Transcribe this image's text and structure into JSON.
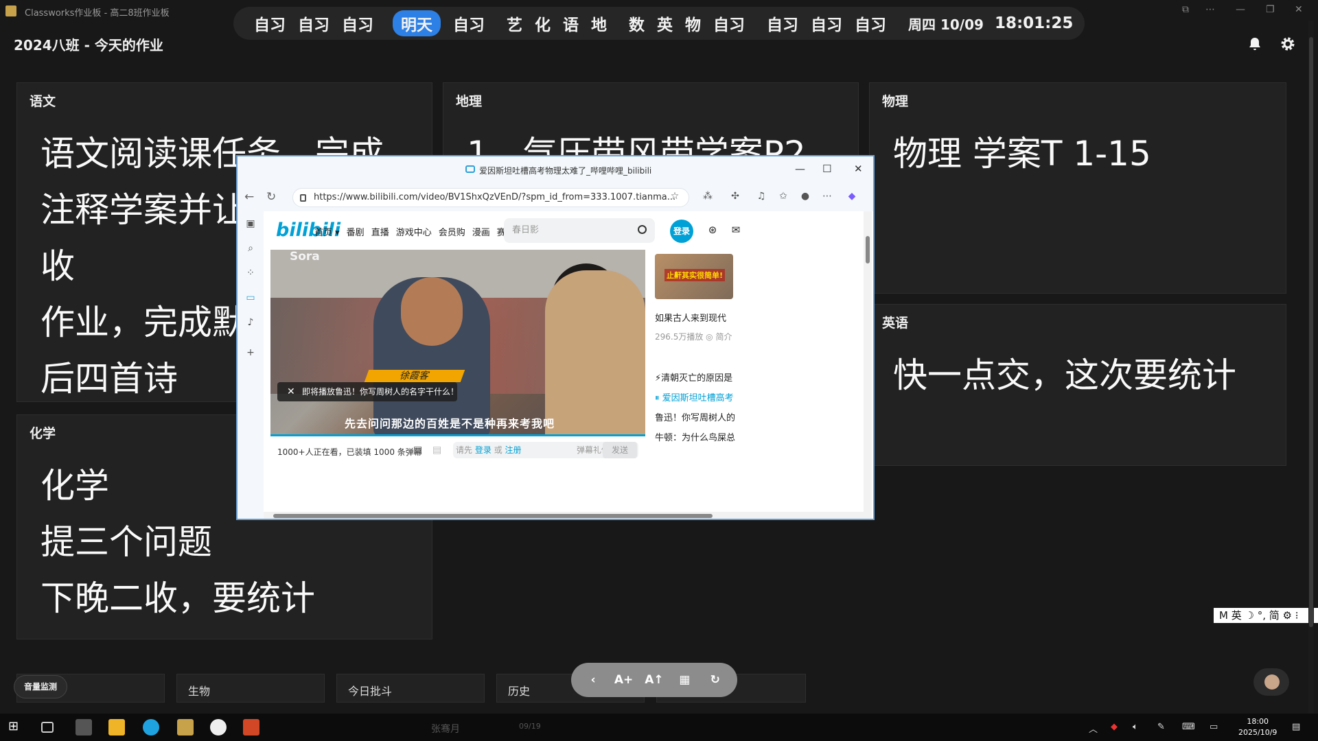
{
  "app": {
    "window_title": "Classworks作业板 - 高二8班作业板",
    "class_title": "2024八班 - 今天的作业"
  },
  "schedule": {
    "group1": [
      "自习",
      "自习",
      "自习"
    ],
    "highlight": "明天",
    "group2_rest": [
      "自习"
    ],
    "group3": [
      "艺",
      "化",
      "语",
      "地"
    ],
    "group4": [
      "数",
      "英",
      "物",
      "自习"
    ],
    "group5": [
      "自习",
      "自习",
      "自习"
    ],
    "weekday_date": "周四 10/09",
    "time": "18:01:25"
  },
  "cards": {
    "chinese": {
      "title": "语文",
      "lines": [
        "语文阅读课任务，完成",
        "注释学案并让课代表收",
        "收",
        "作业，完成默写",
        "后四首诗"
      ]
    },
    "geography": {
      "title": "地理",
      "lines": [
        "1、气压带风带学案P2"
      ]
    },
    "physics": {
      "title": "物理",
      "lines": [
        "物理 学案T 1-15"
      ]
    },
    "english": {
      "title": "英语",
      "lines": [
        "快一点交，这次要统计"
      ]
    },
    "chemistry": {
      "title": "化学",
      "lines": [
        "化学",
        "提三个问题",
        "下晚二收，要统计"
      ]
    }
  },
  "bottom": {
    "volume": "音量监测",
    "cards": [
      "生物",
      "今日批斗",
      "历史"
    ]
  },
  "toolbar": {
    "buttons": [
      "‹",
      "A+",
      "A↑",
      "▦",
      "↻"
    ]
  },
  "ime": {
    "text": "M 英 ☽ °, 简 ⚙ ⁝"
  },
  "browser": {
    "tab_title": "爱因斯坦吐槽高考物理太难了_哔哩哔哩_bilibili",
    "url": "https://www.bilibili.com/video/BV1ShxQzVEnD/?spm_id_from=333.1007.tianma...",
    "logo": "bilibili",
    "nav": [
      "首页 ▾",
      "番剧",
      "直播",
      "游戏中心",
      "会员购",
      "漫画",
      "赛事"
    ],
    "search_placeholder": "春日影",
    "login": "登录",
    "video": {
      "watermark": "Sora",
      "name_tag": "徐霞客",
      "toast": "即将播放鲁迅！你写周树人的名字干什么！",
      "subtitle": "先去问问那边的百姓是不是种再来考我吧"
    },
    "danmaku_bar": {
      "count": "1000+人正在看，已装填 1000 条弹幕",
      "prefix": "请先",
      "login": "登录",
      "or": "或",
      "register": "注册",
      "etiquette": "弹幕礼仪 ›",
      "send": "发送"
    },
    "recommend": {
      "thumb_label": "止鼾其实很简单!",
      "items": [
        {
          "text": "如果古人来到现代",
          "cls": ""
        },
        {
          "text": "296.5万播放  ◎ 简介",
          "cls": "meta"
        },
        {
          "text": "",
          "cls": ""
        },
        {
          "text": "⚡清朝灭亡的原因是",
          "cls": ""
        },
        {
          "text": "⏸ 爱因斯坦吐槽高考",
          "cls": "active"
        },
        {
          "text": "鲁迅！你写周树人的",
          "cls": ""
        },
        {
          "text": "牛顿：为什么鸟屎总",
          "cls": ""
        }
      ]
    }
  },
  "taskbar": {
    "user": "张骞月",
    "date_small": "09/19",
    "time": "18:00",
    "date": "2025/10/9"
  }
}
